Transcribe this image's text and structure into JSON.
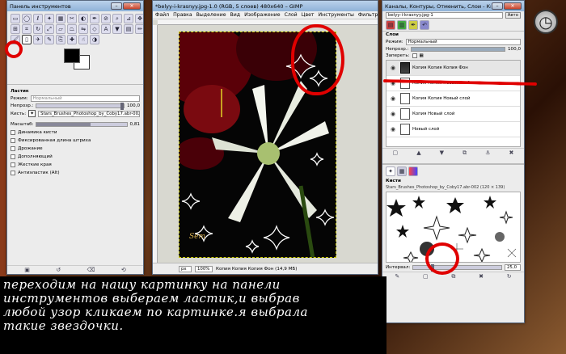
{
  "toolbox": {
    "title": "Панель инструментов",
    "eraser_title": "Ластик",
    "mode_label": "Режим:",
    "mode_value": "Нормальный",
    "opacity_label": "Непрозр.:",
    "opacity_value": "100,0",
    "brush_label": "Кисть:",
    "brush_value": "Stars_Brushes_Photoshop_by_Coby17.abr-002",
    "scale_label": "Масштаб:",
    "scale_value": "0,81",
    "options": [
      "Динамика кисти",
      "Фиксированная длина штриха",
      "Дрожание",
      "Дополняющий",
      "Жесткие края",
      "Антиэластик (Alt)"
    ]
  },
  "image_window": {
    "title": "*belyy-i-krasnyy.jpg-1.0 (RGB, 5 слоев) 480x640 – GIMP",
    "menu": [
      "Файл",
      "Правка",
      "Выделение",
      "Вид",
      "Изображение",
      "Слой",
      "Цвет",
      "Инструменты",
      "Фильтры"
    ],
    "unit": "px",
    "zoom": "100%",
    "status": "Копия Копия Копия Фон (14,9 МБ)",
    "signature": "Sem"
  },
  "layers_window": {
    "title": "Каналы, Контуры, Отменить, Слои - Кисти",
    "image_select": "belyy-i-krasnyy.jpg-1",
    "layers_heading": "Слои",
    "mode_label": "Режим:",
    "mode_value": "Нормальный",
    "opacity_label": "Непрозр.:",
    "opacity_value": "100,0",
    "lock_label": "Запереть:",
    "layers": [
      "Копия Копия Копия Фон",
      "Копия Копия Новый слой",
      "Копия Копия Новый слой",
      "Копия Новый слой",
      "Новый слой"
    ],
    "brushes_heading": "Кисти",
    "brush_name": "Stars_Brushes_Photoshop_by_Coby17.abr-002 (120 × 139)",
    "interval_label": "Интервал:",
    "interval_value": "25,0"
  },
  "caption_lines": [
    "переходим на нашу картинку на панели",
    "инструментов выбераем ластик,и выбрав",
    "любой узор кликаем по картинке.я выбрала",
    "такие звездочки."
  ],
  "clock": {
    "glyph": "◷"
  },
  "colors": {
    "annotation_red": "#e00000",
    "title_blue": "#8fb2d8"
  }
}
